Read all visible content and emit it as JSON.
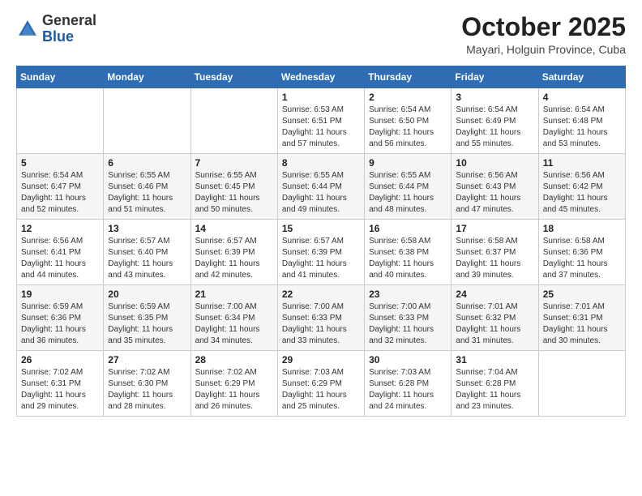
{
  "logo": {
    "general": "General",
    "blue": "Blue"
  },
  "header": {
    "month": "October 2025",
    "location": "Mayari, Holguin Province, Cuba"
  },
  "weekdays": [
    "Sunday",
    "Monday",
    "Tuesday",
    "Wednesday",
    "Thursday",
    "Friday",
    "Saturday"
  ],
  "weeks": [
    [
      {
        "day": "",
        "sunrise": "",
        "sunset": "",
        "daylight": ""
      },
      {
        "day": "",
        "sunrise": "",
        "sunset": "",
        "daylight": ""
      },
      {
        "day": "",
        "sunrise": "",
        "sunset": "",
        "daylight": ""
      },
      {
        "day": "1",
        "sunrise": "Sunrise: 6:53 AM",
        "sunset": "Sunset: 6:51 PM",
        "daylight": "Daylight: 11 hours and 57 minutes."
      },
      {
        "day": "2",
        "sunrise": "Sunrise: 6:54 AM",
        "sunset": "Sunset: 6:50 PM",
        "daylight": "Daylight: 11 hours and 56 minutes."
      },
      {
        "day": "3",
        "sunrise": "Sunrise: 6:54 AM",
        "sunset": "Sunset: 6:49 PM",
        "daylight": "Daylight: 11 hours and 55 minutes."
      },
      {
        "day": "4",
        "sunrise": "Sunrise: 6:54 AM",
        "sunset": "Sunset: 6:48 PM",
        "daylight": "Daylight: 11 hours and 53 minutes."
      }
    ],
    [
      {
        "day": "5",
        "sunrise": "Sunrise: 6:54 AM",
        "sunset": "Sunset: 6:47 PM",
        "daylight": "Daylight: 11 hours and 52 minutes."
      },
      {
        "day": "6",
        "sunrise": "Sunrise: 6:55 AM",
        "sunset": "Sunset: 6:46 PM",
        "daylight": "Daylight: 11 hours and 51 minutes."
      },
      {
        "day": "7",
        "sunrise": "Sunrise: 6:55 AM",
        "sunset": "Sunset: 6:45 PM",
        "daylight": "Daylight: 11 hours and 50 minutes."
      },
      {
        "day": "8",
        "sunrise": "Sunrise: 6:55 AM",
        "sunset": "Sunset: 6:44 PM",
        "daylight": "Daylight: 11 hours and 49 minutes."
      },
      {
        "day": "9",
        "sunrise": "Sunrise: 6:55 AM",
        "sunset": "Sunset: 6:44 PM",
        "daylight": "Daylight: 11 hours and 48 minutes."
      },
      {
        "day": "10",
        "sunrise": "Sunrise: 6:56 AM",
        "sunset": "Sunset: 6:43 PM",
        "daylight": "Daylight: 11 hours and 47 minutes."
      },
      {
        "day": "11",
        "sunrise": "Sunrise: 6:56 AM",
        "sunset": "Sunset: 6:42 PM",
        "daylight": "Daylight: 11 hours and 45 minutes."
      }
    ],
    [
      {
        "day": "12",
        "sunrise": "Sunrise: 6:56 AM",
        "sunset": "Sunset: 6:41 PM",
        "daylight": "Daylight: 11 hours and 44 minutes."
      },
      {
        "day": "13",
        "sunrise": "Sunrise: 6:57 AM",
        "sunset": "Sunset: 6:40 PM",
        "daylight": "Daylight: 11 hours and 43 minutes."
      },
      {
        "day": "14",
        "sunrise": "Sunrise: 6:57 AM",
        "sunset": "Sunset: 6:39 PM",
        "daylight": "Daylight: 11 hours and 42 minutes."
      },
      {
        "day": "15",
        "sunrise": "Sunrise: 6:57 AM",
        "sunset": "Sunset: 6:39 PM",
        "daylight": "Daylight: 11 hours and 41 minutes."
      },
      {
        "day": "16",
        "sunrise": "Sunrise: 6:58 AM",
        "sunset": "Sunset: 6:38 PM",
        "daylight": "Daylight: 11 hours and 40 minutes."
      },
      {
        "day": "17",
        "sunrise": "Sunrise: 6:58 AM",
        "sunset": "Sunset: 6:37 PM",
        "daylight": "Daylight: 11 hours and 39 minutes."
      },
      {
        "day": "18",
        "sunrise": "Sunrise: 6:58 AM",
        "sunset": "Sunset: 6:36 PM",
        "daylight": "Daylight: 11 hours and 37 minutes."
      }
    ],
    [
      {
        "day": "19",
        "sunrise": "Sunrise: 6:59 AM",
        "sunset": "Sunset: 6:36 PM",
        "daylight": "Daylight: 11 hours and 36 minutes."
      },
      {
        "day": "20",
        "sunrise": "Sunrise: 6:59 AM",
        "sunset": "Sunset: 6:35 PM",
        "daylight": "Daylight: 11 hours and 35 minutes."
      },
      {
        "day": "21",
        "sunrise": "Sunrise: 7:00 AM",
        "sunset": "Sunset: 6:34 PM",
        "daylight": "Daylight: 11 hours and 34 minutes."
      },
      {
        "day": "22",
        "sunrise": "Sunrise: 7:00 AM",
        "sunset": "Sunset: 6:33 PM",
        "daylight": "Daylight: 11 hours and 33 minutes."
      },
      {
        "day": "23",
        "sunrise": "Sunrise: 7:00 AM",
        "sunset": "Sunset: 6:33 PM",
        "daylight": "Daylight: 11 hours and 32 minutes."
      },
      {
        "day": "24",
        "sunrise": "Sunrise: 7:01 AM",
        "sunset": "Sunset: 6:32 PM",
        "daylight": "Daylight: 11 hours and 31 minutes."
      },
      {
        "day": "25",
        "sunrise": "Sunrise: 7:01 AM",
        "sunset": "Sunset: 6:31 PM",
        "daylight": "Daylight: 11 hours and 30 minutes."
      }
    ],
    [
      {
        "day": "26",
        "sunrise": "Sunrise: 7:02 AM",
        "sunset": "Sunset: 6:31 PM",
        "daylight": "Daylight: 11 hours and 29 minutes."
      },
      {
        "day": "27",
        "sunrise": "Sunrise: 7:02 AM",
        "sunset": "Sunset: 6:30 PM",
        "daylight": "Daylight: 11 hours and 28 minutes."
      },
      {
        "day": "28",
        "sunrise": "Sunrise: 7:02 AM",
        "sunset": "Sunset: 6:29 PM",
        "daylight": "Daylight: 11 hours and 26 minutes."
      },
      {
        "day": "29",
        "sunrise": "Sunrise: 7:03 AM",
        "sunset": "Sunset: 6:29 PM",
        "daylight": "Daylight: 11 hours and 25 minutes."
      },
      {
        "day": "30",
        "sunrise": "Sunrise: 7:03 AM",
        "sunset": "Sunset: 6:28 PM",
        "daylight": "Daylight: 11 hours and 24 minutes."
      },
      {
        "day": "31",
        "sunrise": "Sunrise: 7:04 AM",
        "sunset": "Sunset: 6:28 PM",
        "daylight": "Daylight: 11 hours and 23 minutes."
      },
      {
        "day": "",
        "sunrise": "",
        "sunset": "",
        "daylight": ""
      }
    ]
  ]
}
